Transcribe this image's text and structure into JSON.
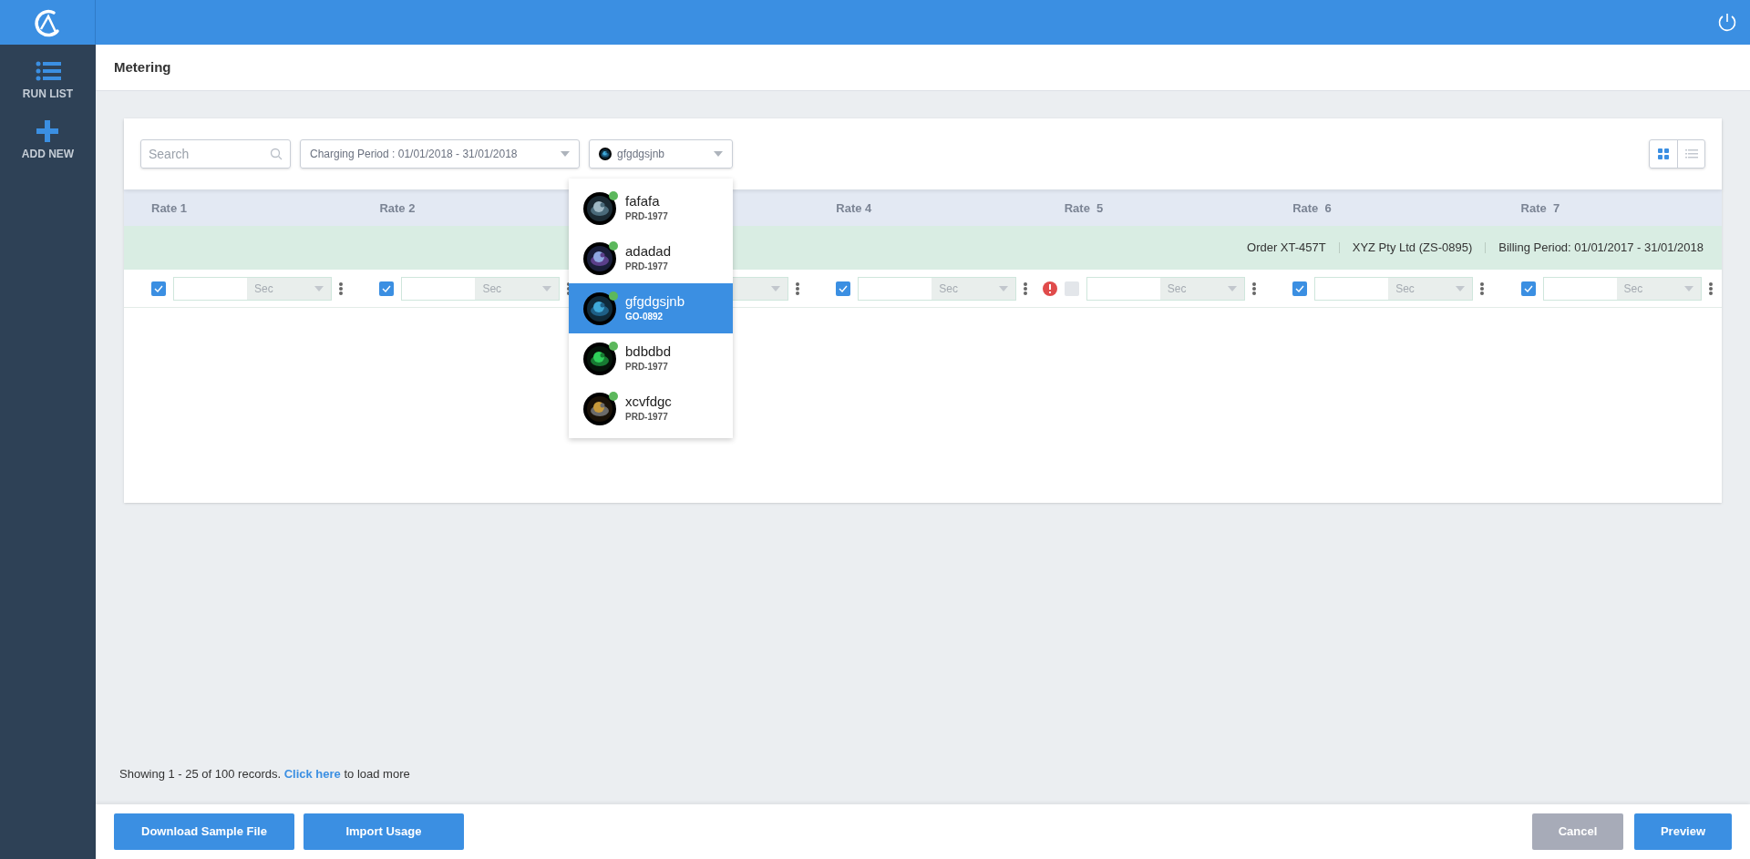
{
  "sidebar": {
    "items": [
      {
        "kind": "list",
        "label": "RUN LIST"
      },
      {
        "kind": "add",
        "label": "ADD NEW"
      }
    ]
  },
  "page_title": "Metering",
  "toolbar": {
    "search": {
      "placeholder": "Search"
    },
    "period_select": {
      "value": "Charging Period : 01/01/2018 - 31/01/2018"
    },
    "user_select": {
      "value": "gfgdgsjnb"
    },
    "view_toggle": [
      {
        "kind": "grid",
        "selected": true
      },
      {
        "kind": "list",
        "selected": false
      }
    ]
  },
  "user_menu": [
    {
      "name": "fafafa",
      "code": "PRD-1977",
      "online": true,
      "selected": false
    },
    {
      "name": "adadad",
      "code": "PRD-1977",
      "online": true,
      "selected": false
    },
    {
      "name": "gfgdgsjnb",
      "code": "GO-0892",
      "online": true,
      "selected": true
    },
    {
      "name": "bdbdbd",
      "code": "PRD-1977",
      "online": true,
      "selected": false
    },
    {
      "name": "xcvfdgc",
      "code": "PRD-1977",
      "online": true,
      "selected": false
    }
  ],
  "columns": [
    {
      "header": "Rate 1",
      "checked": true,
      "error": false,
      "unit": "Sec"
    },
    {
      "header": "Rate 2",
      "checked": true,
      "error": false,
      "unit": "Sec"
    },
    {
      "error": false
    },
    {
      "header": "Rate 4",
      "checked": true,
      "error": false,
      "unit": "Sec"
    },
    {
      "header": "Rate  5",
      "checked": false,
      "error": true,
      "unit": "Sec"
    },
    {
      "header": "Rate  6",
      "checked": true,
      "error": false,
      "unit": "Sec"
    },
    {
      "header": "Rate  7",
      "checked": true,
      "error": false,
      "unit": "Sec"
    }
  ],
  "info_row": [
    "Order XT-457T",
    "XYZ Pty Ltd (ZS-0895)",
    "Billing Period: 01/01/2017 - 31/01/2018"
  ],
  "pagination": {
    "before": "Showing 1 - 25 of 100 records.",
    "link": "Click here",
    "after": "to load more"
  },
  "footer": {
    "left_buttons": [
      "Download Sample File",
      "Import Usage"
    ],
    "cancel": "Cancel",
    "preview": "Preview"
  }
}
